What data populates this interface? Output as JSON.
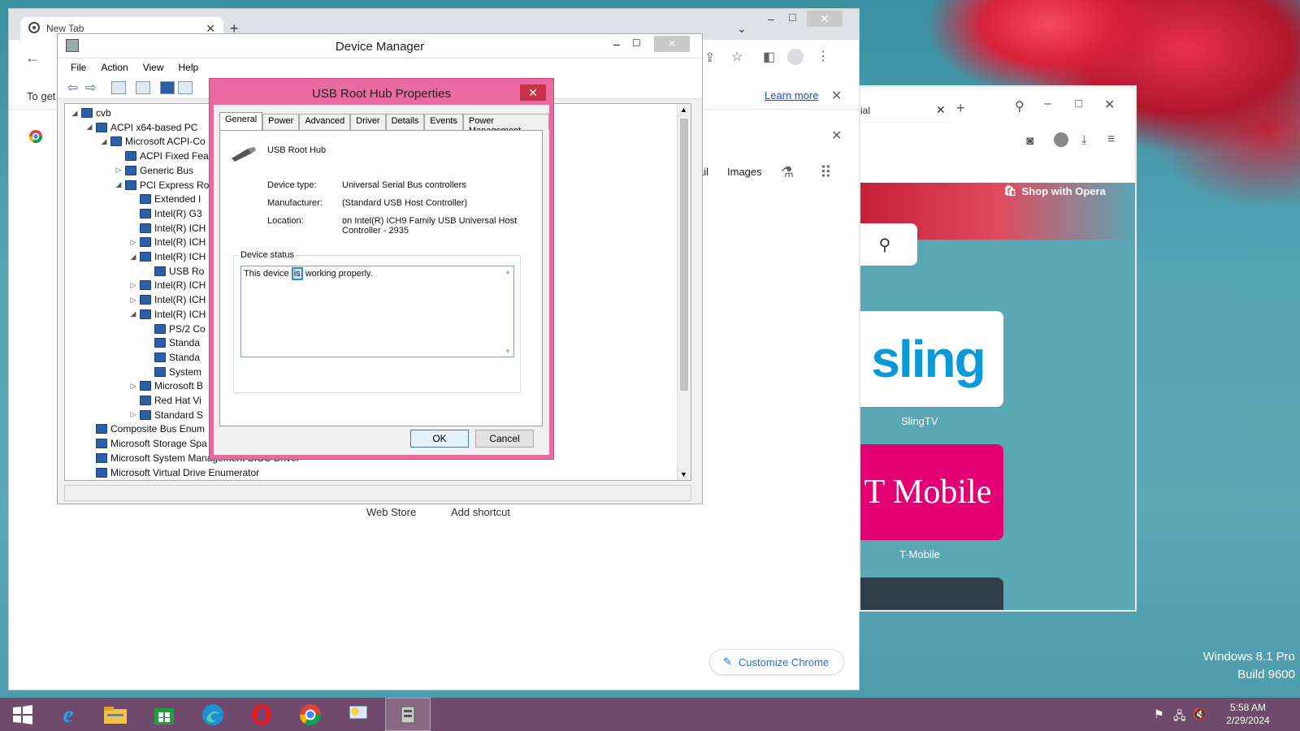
{
  "chrome": {
    "tab_title": "New Tab",
    "infobar_text": "To get",
    "learn_more": "Learn more",
    "search_links": [
      "ail",
      "Images"
    ],
    "shortcuts": [
      "Web Store",
      "Add shortcut"
    ],
    "customize": "Customize Chrome"
  },
  "opera": {
    "tab_title": "ial",
    "shop": "Shop with Opera",
    "tiles": [
      {
        "logo": "sling",
        "label": "SlingTV",
        "color": "#0a9ad7"
      },
      {
        "logo": "T Mobile",
        "label": "T-Mobile",
        "color": "#e20074"
      }
    ]
  },
  "devmgr": {
    "title": "Device Manager",
    "menu": [
      "File",
      "Action",
      "View",
      "Help"
    ],
    "tree": [
      {
        "label": "cvb",
        "exp": "◢",
        "indent": 0
      },
      {
        "label": "ACPI x64-based PC",
        "exp": "◢",
        "indent": 1
      },
      {
        "label": "Microsoft ACPI-Co",
        "exp": "◢",
        "indent": 2
      },
      {
        "label": "ACPI Fixed Fea",
        "exp": "",
        "indent": 3
      },
      {
        "label": "Generic Bus",
        "exp": "▷",
        "indent": 3
      },
      {
        "label": "PCI Express Ro",
        "exp": "◢",
        "indent": 3
      },
      {
        "label": "Extended I",
        "exp": "",
        "indent": 4
      },
      {
        "label": "Intel(R) G3",
        "exp": "",
        "indent": 4
      },
      {
        "label": "Intel(R) ICH",
        "exp": "",
        "indent": 4
      },
      {
        "label": "Intel(R) ICH",
        "exp": "▷",
        "indent": 4
      },
      {
        "label": "Intel(R) ICH",
        "exp": "◢",
        "indent": 4
      },
      {
        "label": "USB Ro",
        "exp": "",
        "indent": 5
      },
      {
        "label": "Intel(R) ICH",
        "exp": "▷",
        "indent": 4
      },
      {
        "label": "Intel(R) ICH",
        "exp": "▷",
        "indent": 4
      },
      {
        "label": "Intel(R) ICH",
        "exp": "◢",
        "indent": 4
      },
      {
        "label": "PS/2 Co",
        "exp": "",
        "indent": 5
      },
      {
        "label": "Standa",
        "exp": "",
        "indent": 5
      },
      {
        "label": "Standa",
        "exp": "",
        "indent": 5
      },
      {
        "label": "System",
        "exp": "",
        "indent": 5
      },
      {
        "label": "Microsoft B",
        "exp": "▷",
        "indent": 4
      },
      {
        "label": "Red Hat Vi",
        "exp": "",
        "indent": 4
      },
      {
        "label": "Standard S",
        "exp": "▷",
        "indent": 4
      },
      {
        "label": "Composite Bus Enum",
        "exp": "",
        "indent": 1
      },
      {
        "label": "Microsoft Storage Spa",
        "exp": "",
        "indent": 1
      },
      {
        "label": "Microsoft System Management BIOS Driver",
        "exp": "",
        "indent": 1
      },
      {
        "label": "Microsoft Virtual Drive Enumerator",
        "exp": "",
        "indent": 1
      }
    ]
  },
  "props": {
    "title": "USB Root Hub Properties",
    "tabs": [
      "General",
      "Power",
      "Advanced",
      "Driver",
      "Details",
      "Events",
      "Power Management"
    ],
    "device_name": "USB Root Hub",
    "device_type_label": "Device type:",
    "device_type": "Universal Serial Bus controllers",
    "manufacturer_label": "Manufacturer:",
    "manufacturer": "(Standard USB Host Controller)",
    "location_label": "Location:",
    "location_line1": "on Intel(R) ICH9 Family USB Universal Host",
    "location_line2": "Controller - 2935",
    "status_group": "Device status",
    "status_pre": "This device",
    "status_sel": "is",
    "status_post": "working properly.",
    "ok": "OK",
    "cancel": "Cancel"
  },
  "taskbar": {
    "apps": [
      "start-icon",
      "internet-explorer-icon",
      "file-explorer-icon",
      "store-icon",
      "edge-icon",
      "opera-icon",
      "chrome-icon",
      "remote-desktop-icon",
      "device-manager-icon"
    ],
    "time": "5:58 AM",
    "date": "2/29/2024"
  },
  "watermark": {
    "line1": "Windows 8.1 Pro",
    "line2": "Build 9600"
  }
}
